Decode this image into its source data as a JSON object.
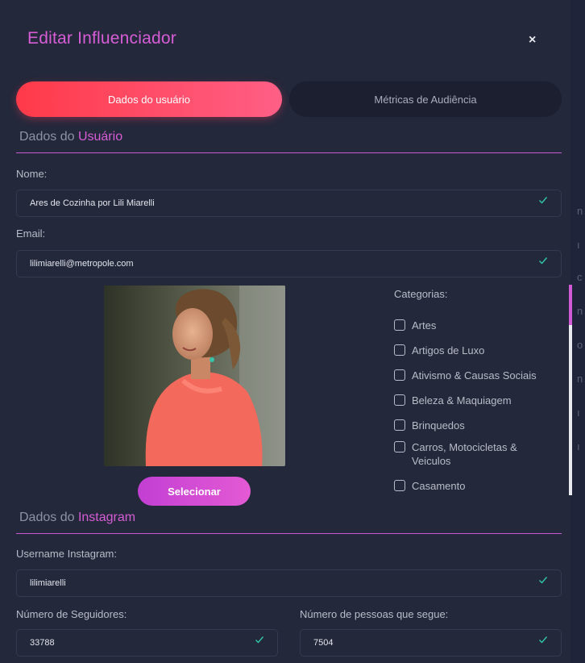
{
  "modal": {
    "title": "Editar Influenciador",
    "close_label": "×"
  },
  "tabs": [
    {
      "label": "Dados do usuário",
      "active": true
    },
    {
      "label": "Métricas de Audiência",
      "active": false
    }
  ],
  "user_section": {
    "heading_prefix": "Dados do",
    "heading_accent": "Usuário",
    "name_label": "Nome:",
    "name_value": "Ares de Cozinha por Lili Miarelli",
    "email_label": "Email:",
    "email_value": "lilimiarelli@metropole.com",
    "select_button": "Selecionar"
  },
  "categories": {
    "label": "Categorias:",
    "items": [
      {
        "label": "Artes",
        "checked": false
      },
      {
        "label": "Artigos de Luxo",
        "checked": false
      },
      {
        "label": "Ativismo & Causas Sociais",
        "checked": false
      },
      {
        "label": "Beleza & Maquiagem",
        "checked": false
      },
      {
        "label": "Brinquedos",
        "checked": false
      },
      {
        "label": "Carros, Motocicletas & Veiculos",
        "checked": false
      },
      {
        "label": "Casamento",
        "checked": false
      }
    ]
  },
  "instagram_section": {
    "heading_prefix": "Dados do",
    "heading_accent": "Instagram",
    "username_label": "Username Instagram:",
    "username_value": "lilimiarelli",
    "followers_label": "Número de Seguidores:",
    "followers_value": "33788",
    "following_label": "Número de pessoas que segue:",
    "following_value": "7504"
  },
  "colors": {
    "accent": "#d75dd6",
    "tab_active_start": "#ff3a49",
    "tab_active_end": "#ff5f86",
    "valid_check": "#2fc9a8",
    "background": "#23283a"
  },
  "icons": {
    "close": "close-icon",
    "valid": "check-icon"
  }
}
